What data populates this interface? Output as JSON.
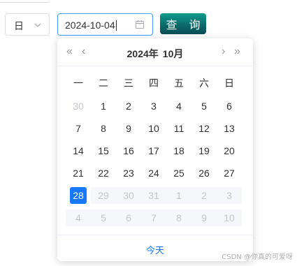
{
  "filter": {
    "period_value": "日",
    "date_value": "2024-10-04",
    "query_label": "查 询"
  },
  "picker": {
    "year_label": "2024年",
    "month_label": "10月",
    "nav": {
      "prev_year": "«",
      "prev_month": "‹",
      "next_month": "›",
      "next_year": "»"
    },
    "weekdays": [
      "一",
      "二",
      "三",
      "四",
      "五",
      "六",
      "日"
    ],
    "days": [
      {
        "d": "30",
        "state": "muted"
      },
      {
        "d": "1"
      },
      {
        "d": "2"
      },
      {
        "d": "3"
      },
      {
        "d": "4"
      },
      {
        "d": "5"
      },
      {
        "d": "6"
      },
      {
        "d": "7"
      },
      {
        "d": "8"
      },
      {
        "d": "9"
      },
      {
        "d": "10"
      },
      {
        "d": "11"
      },
      {
        "d": "12"
      },
      {
        "d": "13"
      },
      {
        "d": "14"
      },
      {
        "d": "15"
      },
      {
        "d": "16"
      },
      {
        "d": "17"
      },
      {
        "d": "18"
      },
      {
        "d": "19"
      },
      {
        "d": "20"
      },
      {
        "d": "21"
      },
      {
        "d": "22"
      },
      {
        "d": "23"
      },
      {
        "d": "24"
      },
      {
        "d": "25"
      },
      {
        "d": "26"
      },
      {
        "d": "27"
      },
      {
        "d": "28",
        "state": "selected"
      },
      {
        "d": "29",
        "state": "disabled"
      },
      {
        "d": "30",
        "state": "disabled"
      },
      {
        "d": "31",
        "state": "disabled"
      },
      {
        "d": "1",
        "state": "disabled"
      },
      {
        "d": "2",
        "state": "disabled"
      },
      {
        "d": "3",
        "state": "disabled"
      },
      {
        "d": "4",
        "state": "disabled"
      },
      {
        "d": "5",
        "state": "disabled"
      },
      {
        "d": "6",
        "state": "disabled"
      },
      {
        "d": "7",
        "state": "disabled"
      },
      {
        "d": "8",
        "state": "disabled"
      },
      {
        "d": "9",
        "state": "disabled"
      },
      {
        "d": "10",
        "state": "disabled"
      }
    ],
    "today_label": "今天"
  },
  "watermark": "CSDN @你真的可爱呀",
  "colors": {
    "accent": "#1677ff",
    "focus_border": "#409eff",
    "button_top": "#0f9b8e",
    "button_bottom": "#0a4d55"
  }
}
